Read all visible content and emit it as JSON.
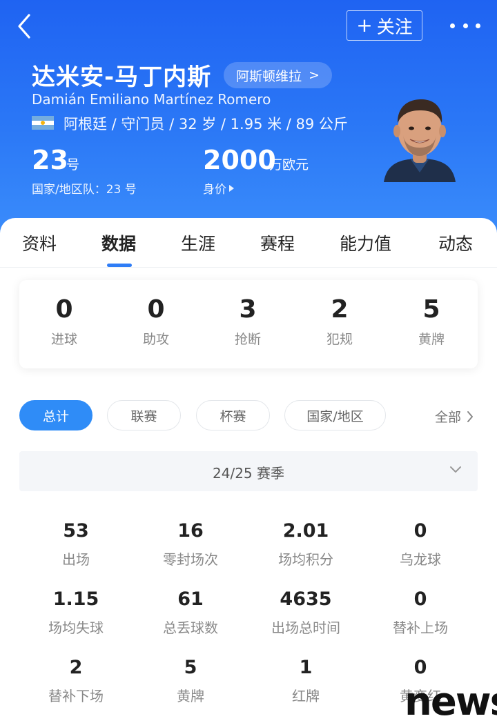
{
  "header": {
    "follow_label": "关注",
    "player_name": "达米安-马丁内斯",
    "club": "阿斯顿维拉",
    "club_arrow": ">",
    "full_name": "Damián Emiliano Martínez Romero",
    "meta": "阿根廷 / 守门员 / 32 岁 / 1.95 米 / 89 公斤",
    "shirt_number": "23",
    "shirt_unit": "号",
    "national_team": "国家/地区队：23 号",
    "market_value": "2000",
    "market_value_unit": "万欧元",
    "market_value_label": "身价"
  },
  "tabs": [
    {
      "label": "资料"
    },
    {
      "label": "数据"
    },
    {
      "label": "生涯"
    },
    {
      "label": "赛程"
    },
    {
      "label": "能力值"
    },
    {
      "label": "动态"
    }
  ],
  "active_tab": "数据",
  "summary": [
    {
      "value": "0",
      "label": "进球"
    },
    {
      "value": "0",
      "label": "助攻"
    },
    {
      "value": "3",
      "label": "抢断"
    },
    {
      "value": "2",
      "label": "犯规"
    },
    {
      "value": "5",
      "label": "黄牌"
    }
  ],
  "filters": [
    {
      "label": "总计",
      "active": true
    },
    {
      "label": "联赛",
      "active": false
    },
    {
      "label": "杯赛",
      "active": false
    },
    {
      "label": "国家/地区",
      "active": false
    }
  ],
  "all_link": "全部",
  "season": "24/25 赛季",
  "stats": [
    {
      "value": "53",
      "label": "出场"
    },
    {
      "value": "16",
      "label": "零封场次"
    },
    {
      "value": "2.01",
      "label": "场均积分"
    },
    {
      "value": "0",
      "label": "乌龙球"
    },
    {
      "value": "1.15",
      "label": "场均失球"
    },
    {
      "value": "61",
      "label": "总丢球数"
    },
    {
      "value": "4635",
      "label": "出场总时间"
    },
    {
      "value": "0",
      "label": "替补上场"
    },
    {
      "value": "2",
      "label": "替补下场"
    },
    {
      "value": "5",
      "label": "黄牌"
    },
    {
      "value": "1",
      "label": "红牌"
    },
    {
      "value": "0",
      "label": "黄变红"
    }
  ],
  "watermark": "news",
  "colors": {
    "header_blue": "#2b78f6",
    "accent": "#2f8cf7"
  }
}
